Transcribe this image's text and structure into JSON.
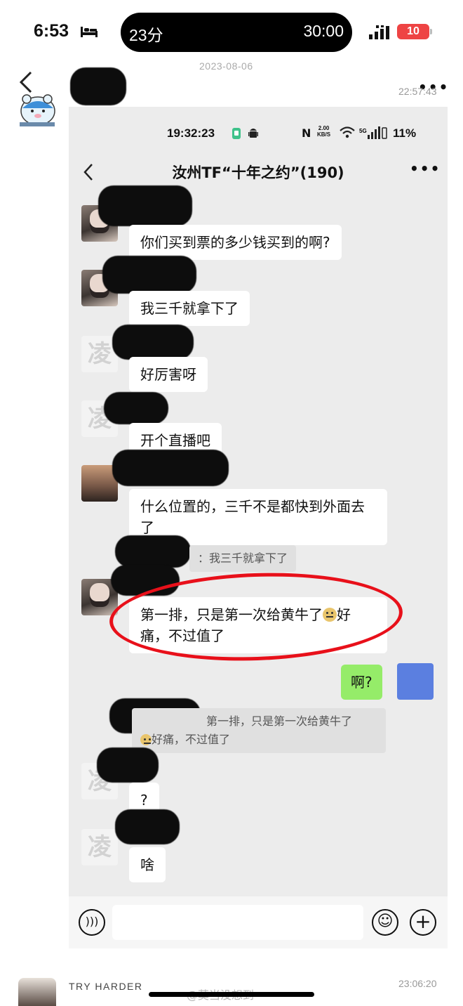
{
  "status_bar": {
    "time": "6:53",
    "island_left": "23分",
    "island_right": "30:00",
    "battery": "10"
  },
  "post": {
    "date": "2023-08-06",
    "time": "22:57:43",
    "more": "•••"
  },
  "inner": {
    "status_time": "19:32:23",
    "status_speed_top": "2.00",
    "status_speed_bottom": "KB/S",
    "status_battery": "11%",
    "chat_title": "汝州TF“十年之约”(190)",
    "more": "•••",
    "avatar_glyph": "凌",
    "messages": [
      {
        "text": "你们买到票的多少钱买到的啊?"
      },
      {
        "text": "我三千就拿下了"
      },
      {
        "text": "好厉害呀"
      },
      {
        "text": "开个直播吧"
      },
      {
        "text": "什么位置的，三千不是都快到外面去了"
      },
      {
        "text": "第一排，只是第一次给黄牛了",
        "text_after": "好痛，不过值了"
      },
      {
        "text": "?"
      },
      {
        "text": "啥"
      }
    ],
    "quote_1": "：我三千就拿下了",
    "quote_2_a": "第一排，只是第一次给黄牛了",
    "quote_2_b": "好痛，不过值了",
    "my_message": "啊?"
  },
  "next_post": {
    "name": "TRY HARDER",
    "time": "23:06:20"
  },
  "watermark": "@莫当没想到"
}
